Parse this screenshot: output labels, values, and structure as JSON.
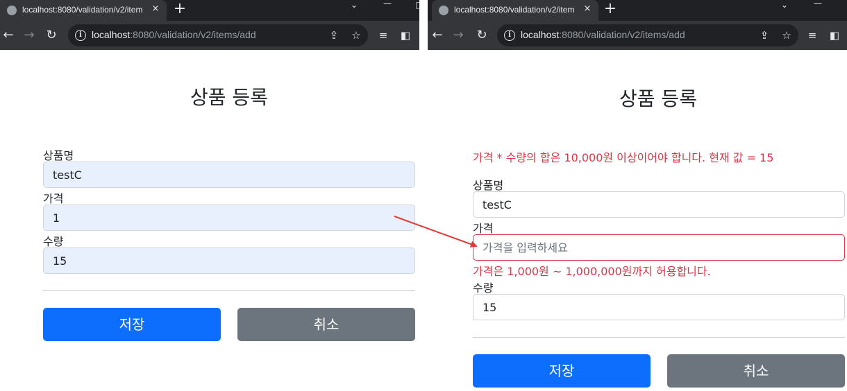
{
  "left": {
    "tab": {
      "title": "localhost:8080/validation/v2/item",
      "close": "×"
    },
    "new_tab": "+",
    "url": {
      "host": "localhost",
      "rest": ":8080/validation/v2/items/add"
    },
    "page": {
      "title": "상품 등록",
      "fields": [
        {
          "label": "상품명",
          "value": "testC"
        },
        {
          "label": "가격",
          "value": "1"
        },
        {
          "label": "수량",
          "value": "15"
        }
      ],
      "save_label": "저장",
      "cancel_label": "취소"
    }
  },
  "right": {
    "tab": {
      "title": "localhost:8080/validation/v2/item",
      "close": "×"
    },
    "new_tab": "+",
    "url": {
      "host": "localhost",
      "rest": ":8080/validation/v2/items/add"
    },
    "page": {
      "title": "상품 등록",
      "global_error": "가격 * 수량의 합은 10,000원 이상이어야 합니다. 현재 값 = 15",
      "fields": [
        {
          "label": "상품명",
          "value": "testC"
        },
        {
          "label": "가격",
          "value": "",
          "placeholder": "가격을 입력하세요",
          "error": "가격은 1,000원 ~ 1,000,000원까지 허용합니다."
        },
        {
          "label": "수량",
          "value": "15"
        }
      ],
      "save_label": "저장",
      "cancel_label": "취소"
    }
  },
  "colors": {
    "primary": "#0d6efd",
    "secondary": "#6c757d",
    "error": "#dc3545",
    "autofill": "#e8f0fe",
    "annotation_arrow": "#e53935"
  }
}
